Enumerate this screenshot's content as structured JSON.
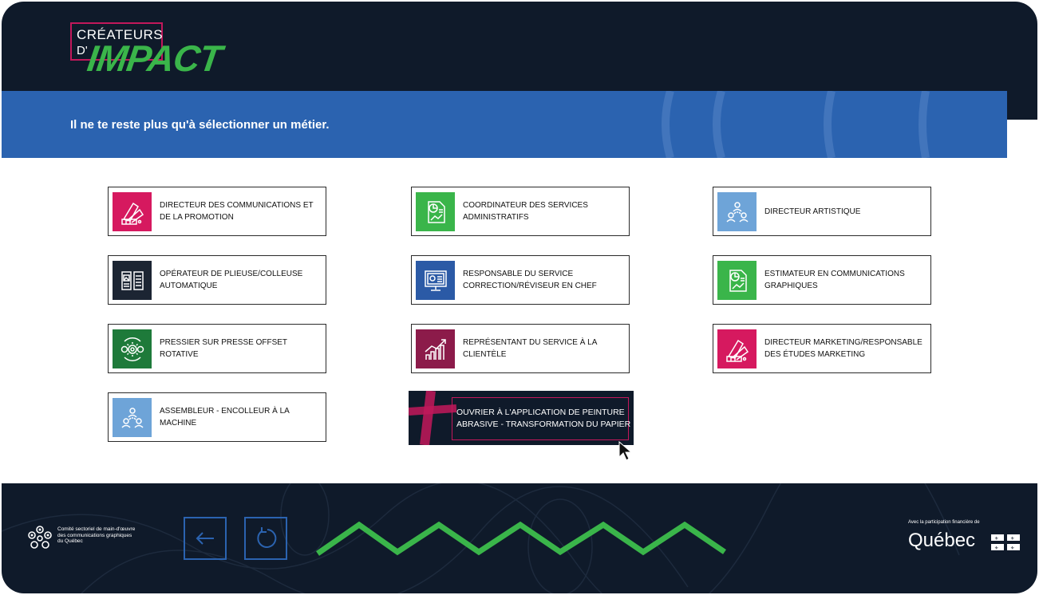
{
  "logo": {
    "top": "CRÉATEURS",
    "d": "D'",
    "impact": "IMPACT"
  },
  "banner": {
    "title": "Il ne te reste plus qu'à sélectionner un métier."
  },
  "jobs": [
    {
      "icon": "color-swatches-icon",
      "color": "#d6195f",
      "line1": "DIRECTEUR DES COMMUNICATIONS ET",
      "line2": "DE LA PROMOTION"
    },
    {
      "icon": "document-chart-icon",
      "color": "#3ab54a",
      "line1": "COORDINATEUR DES SERVICES",
      "line2": "ADMINISTRATIFS"
    },
    {
      "icon": "team-network-icon",
      "color": "#6ea4d8",
      "line1": "DIRECTEUR ARTISTIQUE",
      "line2": ""
    },
    {
      "icon": "open-book-icon",
      "color": "#1c2533",
      "line1": "OPÉRATEUR DE PLIEUSE/COLLEUSE",
      "line2": "AUTOMATIQUE"
    },
    {
      "icon": "monitor-settings-icon",
      "color": "#2b5aa6",
      "line1": "RESPONSABLE DU SERVICE",
      "line2": "CORRECTION/RÉVISEUR EN CHEF"
    },
    {
      "icon": "document-chart-icon",
      "color": "#3ab54a",
      "line1": "ESTIMATEUR EN COMMUNICATIONS",
      "line2": "GRAPHIQUES"
    },
    {
      "icon": "gears-icon",
      "color": "#1e7a3a",
      "line1": "PRESSIER SUR PRESSE OFFSET ROTATIVE",
      "line2": ""
    },
    {
      "icon": "growth-chart-icon",
      "color": "#8c1b4a",
      "line1": "REPRÉSENTANT DU SERVICE À LA",
      "line2": "CLIENTÈLE"
    },
    {
      "icon": "color-swatches-icon",
      "color": "#d6195f",
      "line1": "DIRECTEUR MARKETING/RESPONSABLE",
      "line2": "DES ÉTUDES MARKETING"
    },
    {
      "icon": "team-network-icon",
      "color": "#6ea4d8",
      "line1": "ASSEMBLEUR - ENCOLLEUR À LA MACHINE",
      "line2": ""
    }
  ],
  "selected_job": {
    "line1": "OUVRIER À L'APPLICATION DE PEINTURE",
    "line2": "ABRASIVE - TRANSFORMATION DU PAPIER"
  },
  "footer": {
    "csmo_line1": "Comité sectoriel de main-d'œuvre",
    "csmo_line2": "des communications graphiques",
    "csmo_line3": "du Québec",
    "back_icon": "arrow-left-icon",
    "restart_icon": "restart-icon",
    "quebec_small": "Avec la participation financière de",
    "quebec_word": "Québec"
  },
  "colors": {
    "navy": "#0f1a2a",
    "blue": "#2b63b0",
    "green": "#3ab54a",
    "magenta": "#c2185b"
  }
}
